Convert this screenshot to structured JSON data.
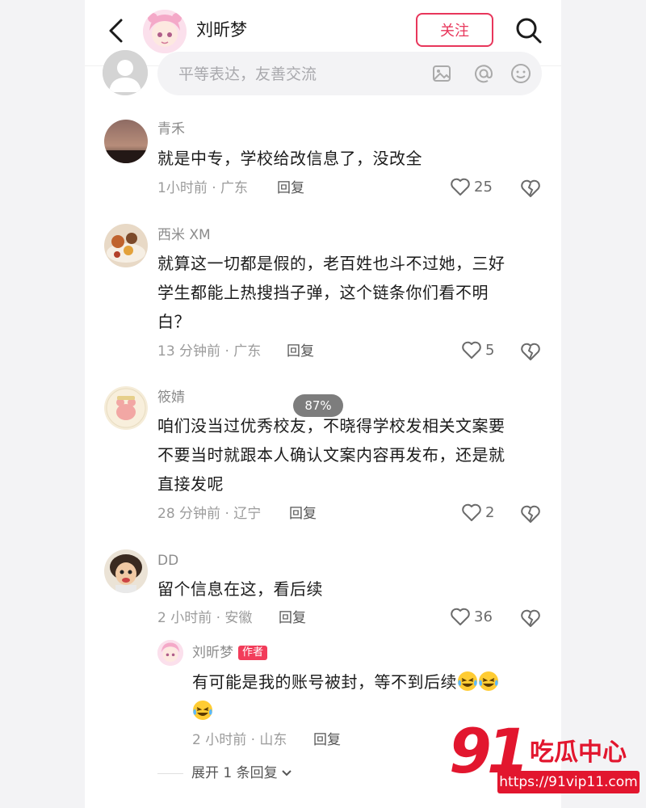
{
  "header": {
    "name": "刘昕梦",
    "follow_label": "关注"
  },
  "composer": {
    "placeholder": "平等表达，友善交流"
  },
  "zoom": "87%",
  "comments": [
    {
      "name": "青禾",
      "lines": [
        "就是中专，学校给改信息了，没改全"
      ],
      "meta": "1小时前 · 广东",
      "reply_label": "回复",
      "likes": "25"
    },
    {
      "name": "西米 XM",
      "lines": [
        "就算这一切都是假的，老百姓也斗不过她，三好",
        "学生都能上热搜挡子弹，这个链条你们看不明",
        "白？"
      ],
      "meta": "13 分钟前 · 广东",
      "reply_label": "回复",
      "likes": "5"
    },
    {
      "name": "筱婧",
      "lines": [
        "咱们没当过优秀校友，不晓得学校发相关文案要",
        "不要当时就跟本人确认文案内容再发布，还是就",
        "直接发呢"
      ],
      "meta": "28 分钟前 · 辽宁",
      "reply_label": "回复",
      "likes": "2"
    },
    {
      "name": "DD",
      "lines": [
        "留个信息在这，看后续"
      ],
      "meta": "2 小时前 · 安徽",
      "reply_label": "回复",
      "likes": "36"
    }
  ],
  "reply": {
    "name": "刘昕梦",
    "author_tag": "作者",
    "text": "有可能是我的账号被封，等不到后续",
    "meta": "2 小时前 · 山东",
    "reply_label": "回复"
  },
  "expand_label": "展开 1 条回复",
  "watermark": {
    "big": "91",
    "cn": "吃瓜中心",
    "url": "https://91vip11.com"
  },
  "colors": {
    "accent": "#e8365b",
    "watermark": "#e2162e"
  }
}
